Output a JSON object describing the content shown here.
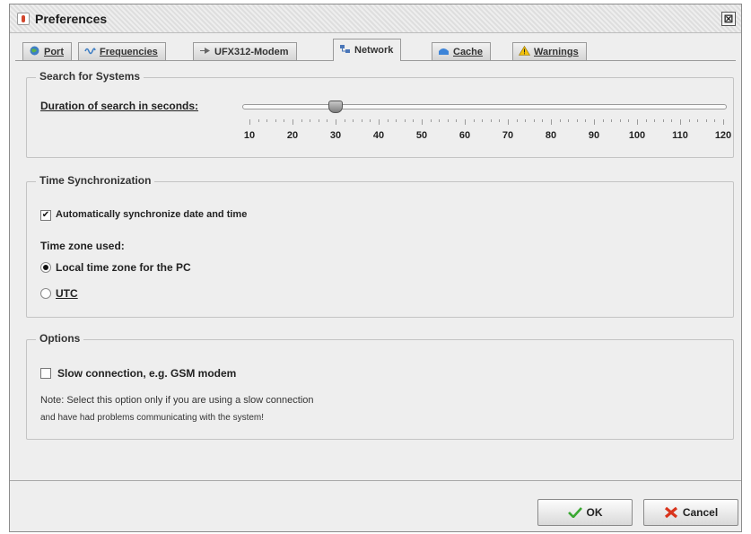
{
  "window": {
    "title": "Preferences",
    "close_glyph": "⊠"
  },
  "tabs": [
    {
      "label": "Port",
      "icon": "globe-icon",
      "mnemonic": "P"
    },
    {
      "label": "Frequencies",
      "icon": "waveform-icon",
      "mnemonic": "F"
    },
    {
      "label": "UFX312-Modem",
      "icon": "modem-icon",
      "mnemonic": "M"
    },
    {
      "label": "Network",
      "icon": "network-icon",
      "mnemonic": "N",
      "active": true
    },
    {
      "label": "Cache",
      "icon": "cache-icon",
      "mnemonic": "C"
    },
    {
      "label": "Warnings",
      "icon": "warning-icon",
      "mnemonic": "W"
    }
  ],
  "search": {
    "group_title": "Search for Systems",
    "duration_label": "Duration of search in seconds:",
    "slider": {
      "min": 10,
      "max": 120,
      "value": 30,
      "ticks": [
        "10",
        "20",
        "30",
        "40",
        "50",
        "60",
        "70",
        "80",
        "90",
        "100",
        "110",
        "120"
      ]
    }
  },
  "timesync": {
    "group_title": "Time Synchronization",
    "auto_sync_label": "Automatically synchronize date and time",
    "auto_sync_checked": true,
    "timezone_label": "Time zone used:",
    "local_label": "Local time zone for the PC",
    "utc_label": "UTC",
    "selected": "local"
  },
  "options": {
    "group_title": "Options",
    "slow_label": "Slow connection, e.g. GSM modem",
    "slow_checked": false,
    "note_line1": "Note: Select this option only if you are using a slow connection",
    "note_line2": "and have had problems communicating with the system!"
  },
  "buttons": {
    "ok": "OK",
    "cancel": "Cancel",
    "ok_color": "#3aa832",
    "cancel_color": "#d9341c"
  }
}
